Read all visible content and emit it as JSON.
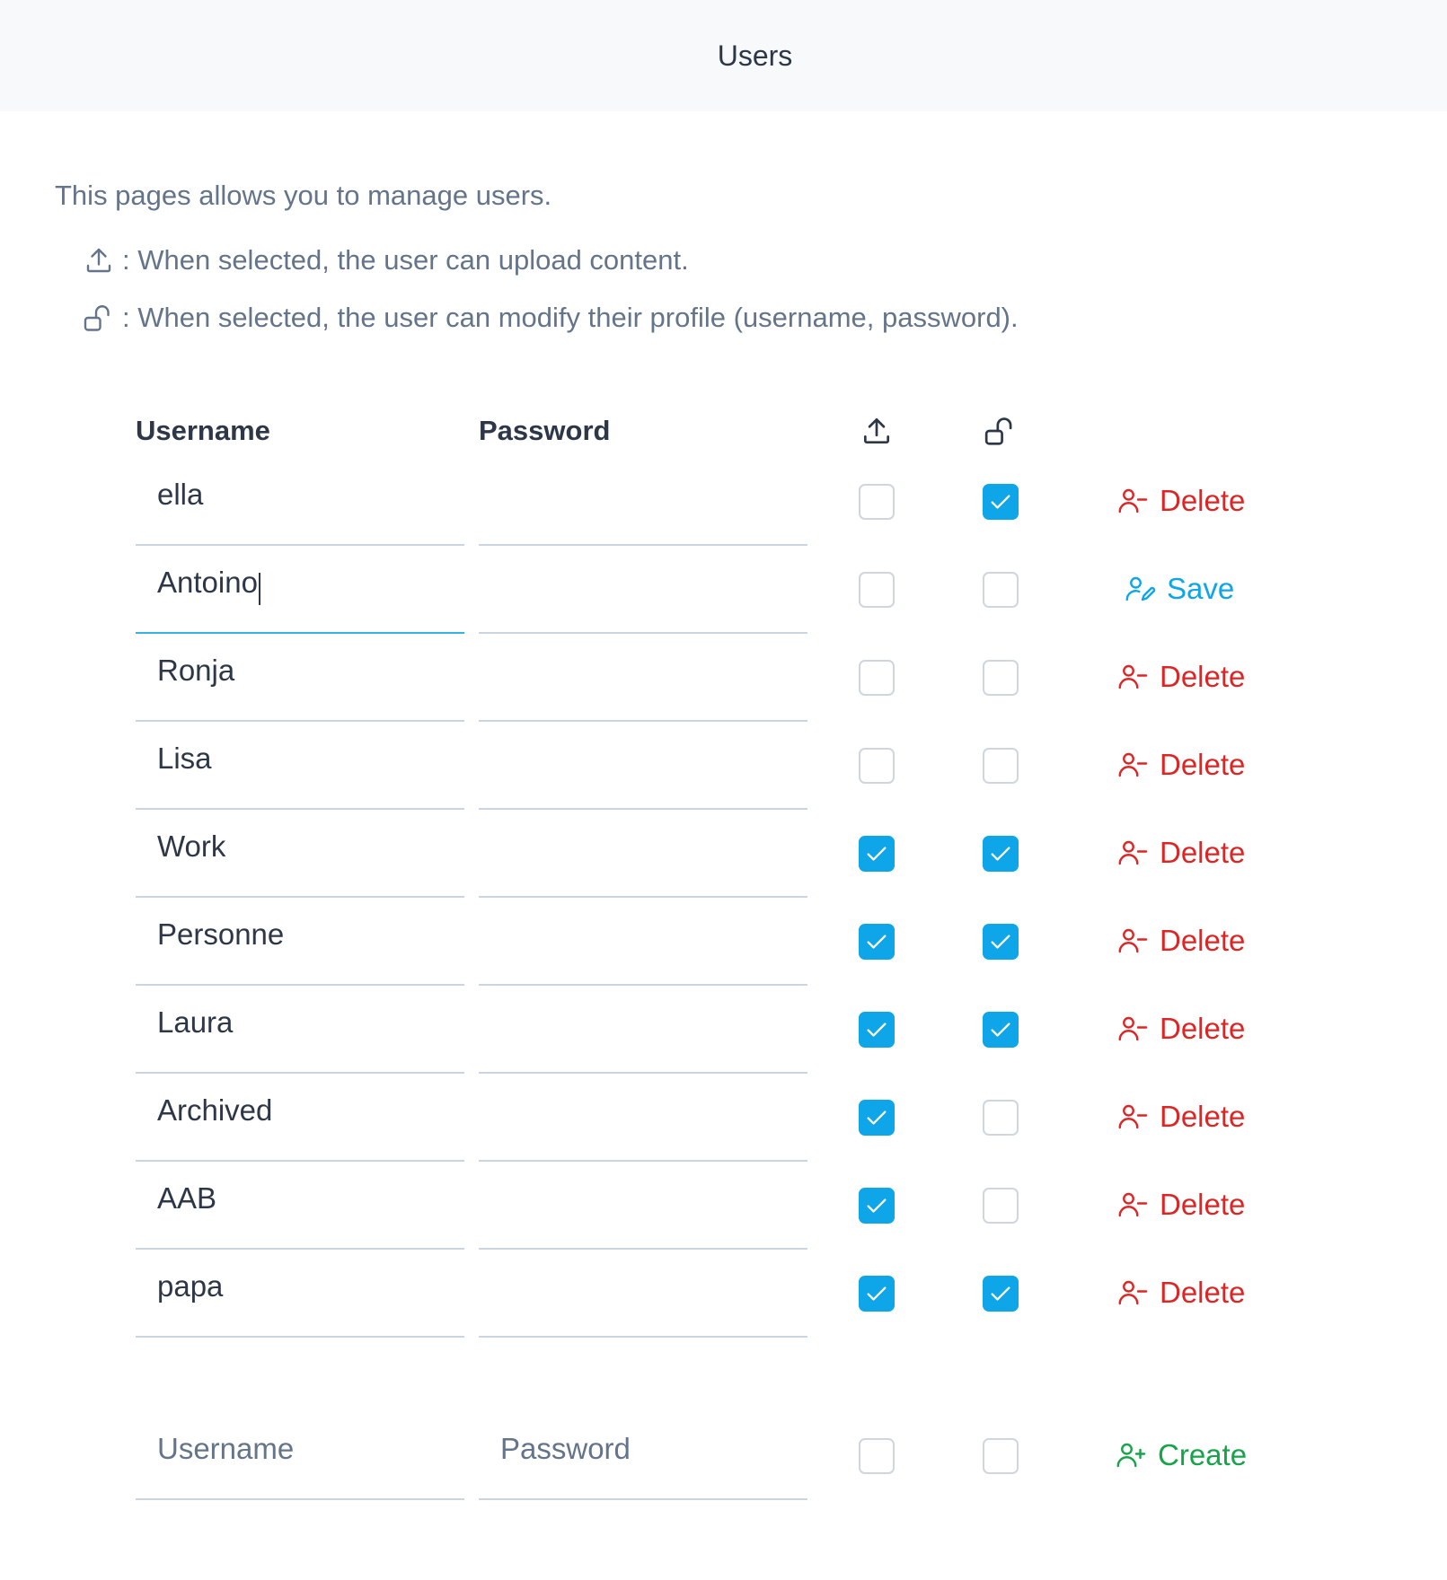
{
  "header": {
    "title": "Users"
  },
  "intro": {
    "text": "This pages allows you to manage users.",
    "upload_legend": ": When selected, the user can upload content.",
    "profile_legend": ": When selected, the user can modify their profile (username, password)."
  },
  "table": {
    "col_username": "Username",
    "col_password": "Password",
    "rows": [
      {
        "username": "ella",
        "upload": false,
        "profile": true,
        "action": "Delete"
      },
      {
        "username": "Antoino",
        "upload": false,
        "profile": false,
        "action": "Save",
        "editing": true
      },
      {
        "username": "Ronja",
        "upload": false,
        "profile": false,
        "action": "Delete"
      },
      {
        "username": "Lisa",
        "upload": false,
        "profile": false,
        "action": "Delete"
      },
      {
        "username": "Work",
        "upload": true,
        "profile": true,
        "action": "Delete"
      },
      {
        "username": "Personne",
        "upload": true,
        "profile": true,
        "action": "Delete"
      },
      {
        "username": "Laura",
        "upload": true,
        "profile": true,
        "action": "Delete"
      },
      {
        "username": "Archived",
        "upload": true,
        "profile": false,
        "action": "Delete"
      },
      {
        "username": "AAB",
        "upload": true,
        "profile": false,
        "action": "Delete"
      },
      {
        "username": "papa",
        "upload": true,
        "profile": true,
        "action": "Delete"
      }
    ]
  },
  "new_user": {
    "username_placeholder": "Username",
    "password_placeholder": "Password",
    "create_label": "Create"
  },
  "colors": {
    "accent": "#0ea5e9",
    "delete": "#dc2626",
    "create": "#16a34a"
  }
}
